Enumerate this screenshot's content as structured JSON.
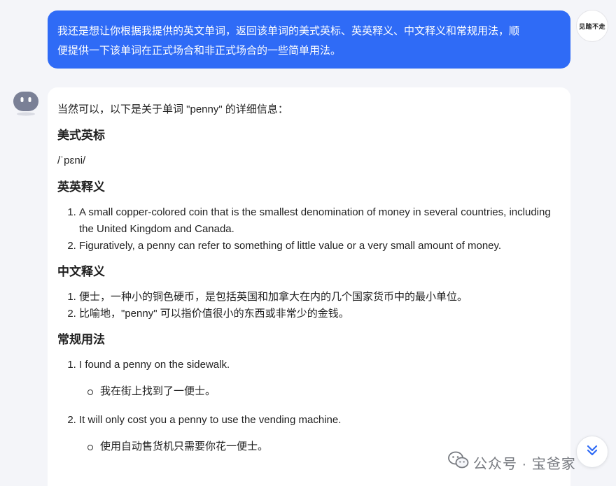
{
  "user_message": {
    "line1": "我还是想让你根据我提供的英文单词，返回该单词的美式英标、英英释义、中文释义和常规用法，顺",
    "line2": "便提供一下该单词在正式场合和非正式场合的一些简单用法。"
  },
  "user_avatar": {
    "label": "见踏不走"
  },
  "reply": {
    "intro": "当然可以，以下是关于单词 \"penny\" 的详细信息：",
    "sections": {
      "pronunciation": {
        "heading": "美式英标",
        "ipa": "/ˈpɛni/"
      },
      "english_definition": {
        "heading": "英英释义",
        "items": [
          "A small copper-colored coin that is the smallest denomination of money in several countries, including the United Kingdom and Canada.",
          "Figuratively, a penny can refer to something of little value or a very small amount of money."
        ]
      },
      "chinese_definition": {
        "heading": "中文释义",
        "items": [
          "便士，一种小的铜色硬币，是包括英国和加拿大在内的几个国家货币中的最小单位。",
          "比喻地，\"penny\" 可以指价值很小的东西或非常少的金钱。"
        ]
      },
      "usage": {
        "heading": "常规用法",
        "items": [
          {
            "example": "I found a penny on the sidewalk.",
            "translation": "我在街上找到了一便士。"
          },
          {
            "example": "It will only cost you a penny to use the vending machine.",
            "translation": "使用自动售货机只需要你花一便士。"
          }
        ]
      }
    }
  },
  "watermark": {
    "text": "公众号 · 宝爸家",
    "icon": "wechat-icon"
  },
  "icons": {
    "scroll": "chevron-double-down-icon",
    "bot": "bot-avatar-icon"
  },
  "colors": {
    "accent": "#2f6bf6",
    "background": "#f4f5f9",
    "card": "#ffffff"
  }
}
